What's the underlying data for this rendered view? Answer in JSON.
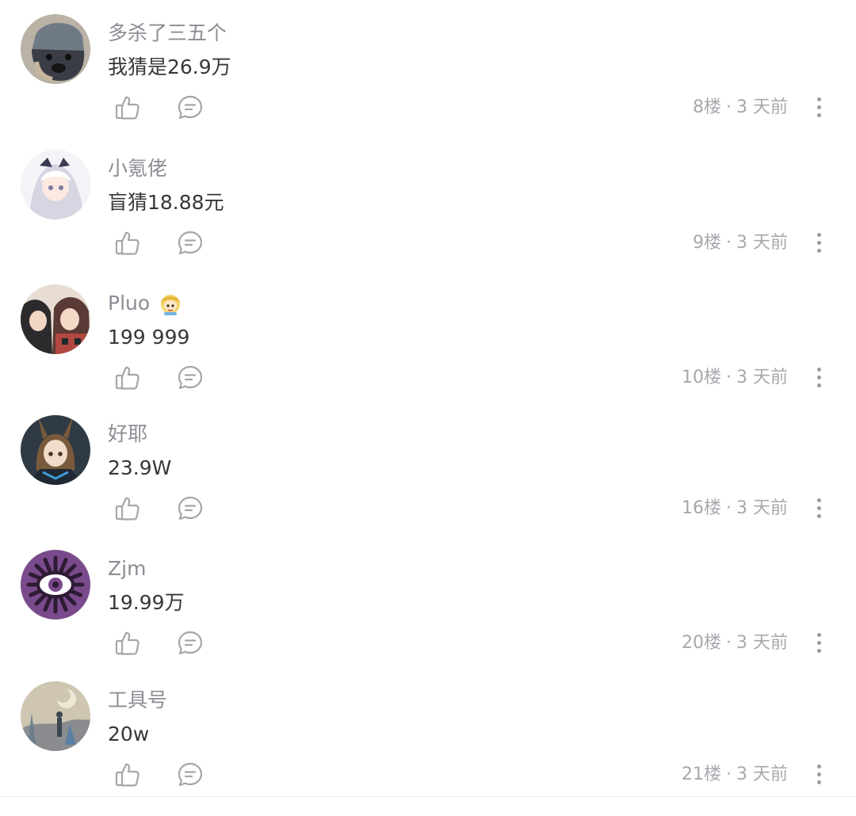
{
  "comments": [
    {
      "username": "多杀了三五个",
      "text": "我猜是26.9万",
      "floor": "8楼",
      "time": "3 天前",
      "has_badge": false,
      "avatar": {
        "icon": "avatar-dog",
        "colors": [
          "#6f7a86",
          "#3a3d45",
          "#c8b79e"
        ]
      }
    },
    {
      "username": "小氪佬",
      "text": "盲猜18.88元",
      "floor": "9楼",
      "time": "3 天前",
      "has_badge": false,
      "avatar": {
        "icon": "avatar-anime-white-hair",
        "colors": [
          "#f4f4f8",
          "#d6d6e2",
          "#7e7a9c"
        ]
      }
    },
    {
      "username": "Pluo",
      "text": "199 999",
      "floor": "10楼",
      "time": "3 天前",
      "has_badge": true,
      "avatar": {
        "icon": "avatar-anime-duo",
        "colors": [
          "#5a3a35",
          "#2d2a2d",
          "#b0483f"
        ]
      }
    },
    {
      "username": "好耶",
      "text": "23.9W",
      "floor": "16楼",
      "time": "3 天前",
      "has_badge": false,
      "avatar": {
        "icon": "avatar-anime-bunny",
        "colors": [
          "#2f3a44",
          "#7a5a3d",
          "#3f9ad6"
        ]
      }
    },
    {
      "username": "Zjm",
      "text": "19.99万",
      "floor": "20楼",
      "time": "3 天前",
      "has_badge": false,
      "avatar": {
        "icon": "avatar-purple-eye",
        "colors": [
          "#7a4b8c",
          "#2e1b35",
          "#ffffff"
        ]
      }
    },
    {
      "username": "工具号",
      "text": "20w",
      "floor": "21楼",
      "time": "3 天前",
      "has_badge": false,
      "avatar": {
        "icon": "avatar-painting",
        "colors": [
          "#cfc6b2",
          "#8a8c8f",
          "#5a7fa3"
        ]
      }
    }
  ],
  "separator": "·",
  "icons": {
    "like": "thumbs-up-icon",
    "reply": "comment-bubble-icon",
    "more": "more-vertical-icon",
    "badge": "emoji-badge-icon"
  },
  "colors": {
    "username": "#8a8d93",
    "text": "#36373b",
    "meta": "#a6a8ad",
    "icon": "#a3a6ab"
  }
}
